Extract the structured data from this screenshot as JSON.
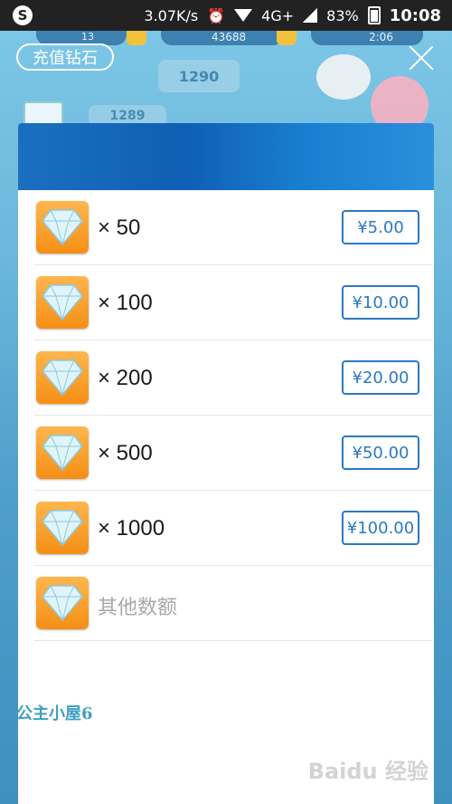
{
  "status_bar": {
    "speed": "3.07K/s",
    "network": "4G+",
    "battery": "83%",
    "time": "10:08"
  },
  "game_bg": {
    "hud_left": "13",
    "hud_coins": "43688",
    "hud_right": "2:06",
    "level_a": "1290",
    "level_b": "1289"
  },
  "top": {
    "pill_label": "充值钻石"
  },
  "packages": [
    {
      "qty": "× 50",
      "price": "¥5.00"
    },
    {
      "qty": "× 100",
      "price": "¥10.00"
    },
    {
      "qty": "× 200",
      "price": "¥20.00"
    },
    {
      "qty": "× 500",
      "price": "¥50.00"
    },
    {
      "qty": "× 1000",
      "price": "¥100.00"
    }
  ],
  "other_amount_label": "其他数额",
  "watermark": "公主小屋6",
  "source_badge": "Baidu 经验",
  "colors": {
    "accent": "#2b79c2",
    "header": "#1b6fc0",
    "gem_tile": "#f58f15"
  }
}
